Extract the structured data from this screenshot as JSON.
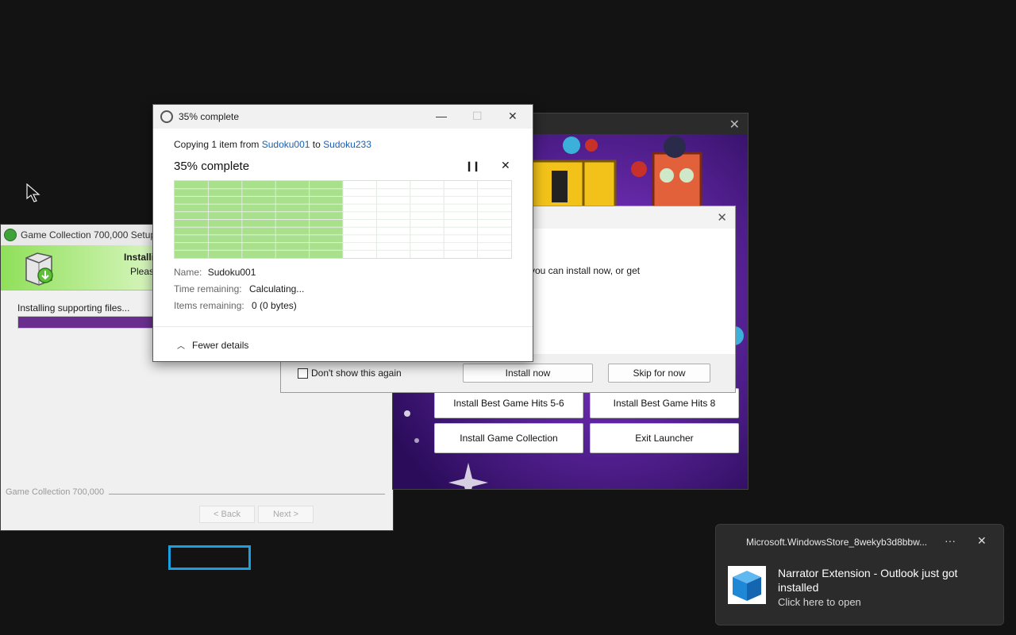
{
  "setup": {
    "title": "Game Collection 700,000 Setup",
    "banner_title": "Installi",
    "banner_sub": "Please",
    "status": "Installing supporting files...",
    "progress": 0.38,
    "brand": "Game Collection 700,000",
    "back_label": "< Back",
    "next_label": "Next >"
  },
  "launcher": {
    "buttons": [
      "Install Best Game Hits 5-6",
      "Install Best Game Hits 8",
      "Install Game Collection",
      "Exit Launcher"
    ]
  },
  "dialog": {
    "message": "you can install now, or get",
    "dont_show": "Don't show this again",
    "install_now": "Install now",
    "skip": "Skip for now"
  },
  "copy": {
    "title": "35% complete",
    "copying_prefix": "Copying 1 item from ",
    "source": "Sudoku001",
    "to_word": " to ",
    "dest": "Sudoku233",
    "percent_label": "35% complete",
    "progress": 0.5,
    "name_key": "Name:",
    "name_val": "Sudoku001",
    "time_key": "Time remaining:",
    "time_val": "Calculating...",
    "items_key": "Items remaining:",
    "items_val": "0 (0 bytes)",
    "fewer": "Fewer details"
  },
  "toast": {
    "app": "Microsoft.WindowsStore_8wekyb3d8bbw...",
    "heading": "Narrator Extension - Outlook just got installed",
    "sub": "Click here to open"
  },
  "colors": {
    "accent": "#1a5fb4",
    "progress_green": "#a8e08c",
    "setup_progress": "#6a2f8e",
    "focus": "#1a9fe0"
  }
}
